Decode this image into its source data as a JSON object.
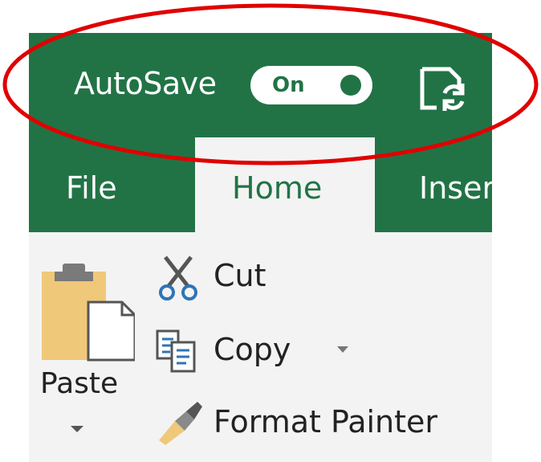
{
  "titlebar": {
    "autosave_label": "AutoSave",
    "autosave_toggle_text": "On",
    "autosave_state": "on",
    "refresh_icon": "refresh-document-icon"
  },
  "tabs": [
    {
      "label": "File",
      "active": false
    },
    {
      "label": "Home",
      "active": true
    },
    {
      "label": "Inser",
      "active": false
    }
  ],
  "clipboard": {
    "paste_label": "Paste",
    "cut_label": "Cut",
    "copy_label": "Copy",
    "format_painter_label": "Format Painter"
  },
  "colors": {
    "brand_green": "#217346",
    "ribbon_bg": "#f3f3f3",
    "annotation_red": "#e00000"
  }
}
